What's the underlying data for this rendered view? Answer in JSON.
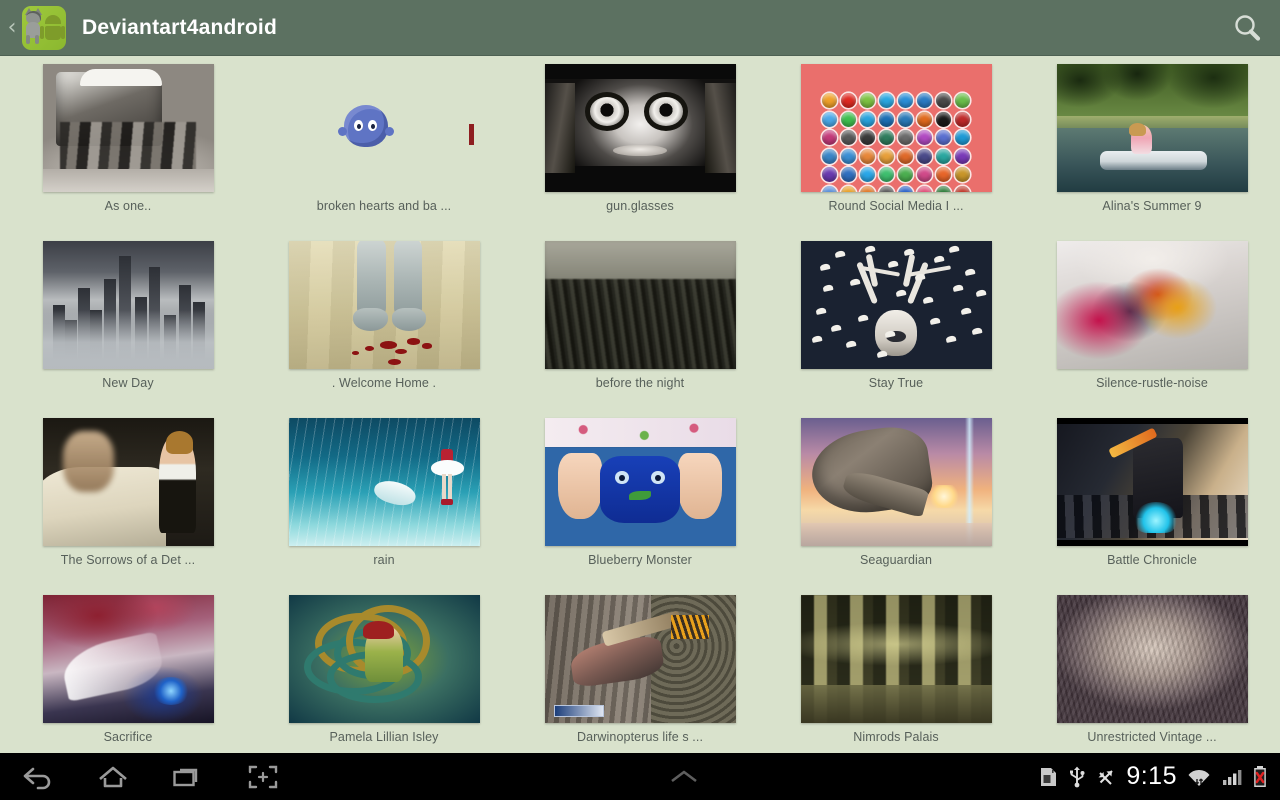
{
  "app": {
    "title": "Deviantart4android",
    "icon_name": "android-wolf-app-icon",
    "accent_bar_color": "#5c7161",
    "background_color": "#d9e2cc",
    "caption_color": "#57605a"
  },
  "actionbar": {
    "up_caret": "‹",
    "search_icon_name": "search-icon",
    "search_label": "Search"
  },
  "grid": {
    "columns": 5,
    "rows": [
      [
        {
          "title": "As one..",
          "art": "a-asone",
          "state": "loaded",
          "thumb_class": "narrow"
        },
        {
          "title": "broken hearts and ba ...",
          "art": "",
          "state": "loading",
          "thumb_class": ""
        },
        {
          "title": "gun.glasses",
          "art": "a-gun",
          "state": "loaded",
          "thumb_class": "tall"
        },
        {
          "title": "Round Social Media I ...",
          "art": "a-social",
          "state": "loaded",
          "thumb_class": "tall"
        },
        {
          "title": "Alina's Summer 9",
          "art": "a-alina",
          "state": "loaded",
          "thumb_class": "tall"
        }
      ],
      [
        {
          "title": "New Day",
          "art": "a-newday",
          "state": "loaded",
          "thumb_class": "narrow"
        },
        {
          "title": ". Welcome Home .",
          "art": "a-welcome",
          "state": "loaded",
          "thumb_class": "tall"
        },
        {
          "title": "before the night",
          "art": "a-before",
          "state": "loaded",
          "thumb_class": "tall"
        },
        {
          "title": "Stay True",
          "art": "a-stay",
          "state": "loaded",
          "thumb_class": "tall"
        },
        {
          "title": "Silence-rustle-noise",
          "art": "a-silence",
          "state": "loaded",
          "thumb_class": "tall"
        }
      ],
      [
        {
          "title": "The Sorrows of a Det ...",
          "art": "a-sorrows",
          "state": "loaded",
          "thumb_class": "narrow"
        },
        {
          "title": "rain",
          "art": "a-rain",
          "state": "loaded",
          "thumb_class": "tall"
        },
        {
          "title": "Blueberry Monster",
          "art": "a-blue",
          "state": "loaded",
          "thumb_class": "tall"
        },
        {
          "title": "Seaguardian",
          "art": "a-sea",
          "state": "loaded",
          "thumb_class": "tall"
        },
        {
          "title": "Battle Chronicle",
          "art": "a-battle",
          "state": "loaded",
          "thumb_class": "tall"
        }
      ],
      [
        {
          "title": "Sacrifice",
          "art": "a-sac",
          "state": "loaded",
          "thumb_class": "narrow"
        },
        {
          "title": "Pamela Lillian Isley",
          "art": "a-pamela",
          "state": "loaded",
          "thumb_class": "tall"
        },
        {
          "title": "Darwinopterus life s ...",
          "art": "a-darwin",
          "state": "loaded",
          "thumb_class": "tall"
        },
        {
          "title": "Nimrods Palais",
          "art": "a-nimrod",
          "state": "loaded",
          "thumb_class": "tall"
        },
        {
          "title": "Unrestricted Vintage ...",
          "art": "a-vintage",
          "state": "loaded",
          "thumb_class": "tall"
        }
      ]
    ]
  },
  "social_icon_colors": [
    "#f0a12a",
    "#e02a22",
    "#7dc242",
    "#2aa7e0",
    "#2a8fd8",
    "#2a7bc4",
    "#4a4a4a",
    "#6abf4b",
    "#4aa8e8",
    "#3fbf4f",
    "#29a3dd",
    "#1b6fb5",
    "#2a7ab8",
    "#e06a1e",
    "#1a1a1a",
    "#c02a2a",
    "#c43a7a",
    "#5a5a5a",
    "#3a3a3a",
    "#2f7d5e",
    "#6b6b6b",
    "#b14ac2",
    "#5a6fd0",
    "#1e9ad6",
    "#3a86c8",
    "#3b8fd4",
    "#e8883a",
    "#e8a03a",
    "#e06a2a",
    "#4a4a8a",
    "#2aa7a0",
    "#7a3ab8",
    "#6a3ab0",
    "#2f6fc0",
    "#2aa7e8",
    "#3fbf6f",
    "#4caf50",
    "#d14a8a",
    "#e8662a",
    "#c9962a",
    "#5a8fd8",
    "#e8a12a",
    "#e07a2a",
    "#5a5a5a",
    "#2a62c8",
    "#e0507a",
    "#2f7d3a",
    "#c0392b",
    "#29b6f6",
    "#2a7ab8"
  ],
  "system_bar": {
    "back_icon": "back-arrow-icon",
    "home_icon": "home-icon",
    "recents_icon": "recent-apps-icon",
    "screenshot_icon": "screenshot-icon",
    "shade_handle_icon": "chevron-up-icon",
    "clock": "9:15",
    "status_icons": [
      "sd-card-icon",
      "usb-icon",
      "sync-icon",
      "wifi-icon",
      "cellular-signal-icon",
      "battery-error-icon"
    ]
  }
}
